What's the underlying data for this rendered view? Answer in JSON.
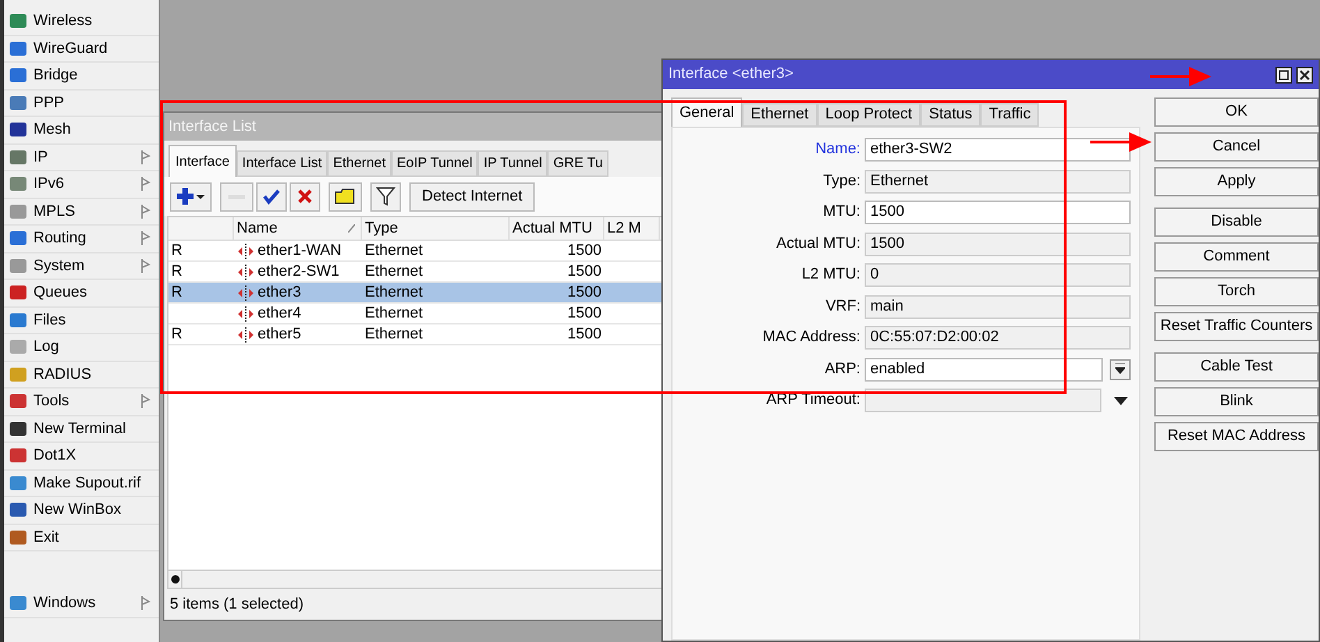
{
  "sidebar": {
    "items": [
      {
        "label": "Wireless",
        "submenu": false
      },
      {
        "label": "WireGuard",
        "submenu": false
      },
      {
        "label": "Bridge",
        "submenu": false
      },
      {
        "label": "PPP",
        "submenu": false
      },
      {
        "label": "Mesh",
        "submenu": false
      },
      {
        "label": "IP",
        "submenu": true
      },
      {
        "label": "IPv6",
        "submenu": true
      },
      {
        "label": "MPLS",
        "submenu": true
      },
      {
        "label": "Routing",
        "submenu": true
      },
      {
        "label": "System",
        "submenu": true
      },
      {
        "label": "Queues",
        "submenu": false
      },
      {
        "label": "Files",
        "submenu": false
      },
      {
        "label": "Log",
        "submenu": false
      },
      {
        "label": "RADIUS",
        "submenu": false
      },
      {
        "label": "Tools",
        "submenu": true
      },
      {
        "label": "New Terminal",
        "submenu": false
      },
      {
        "label": "Dot1X",
        "submenu": false
      },
      {
        "label": "Make Supout.rif",
        "submenu": false
      },
      {
        "label": "New WinBox",
        "submenu": false
      },
      {
        "label": "Exit",
        "submenu": false
      }
    ],
    "bottom_item": {
      "label": "Windows",
      "submenu": true
    }
  },
  "interface_list": {
    "title": "Interface List",
    "tabs": [
      {
        "label": "Interface",
        "selected": true
      },
      {
        "label": "Interface List",
        "selected": false
      },
      {
        "label": "Ethernet",
        "selected": false
      },
      {
        "label": "EoIP Tunnel",
        "selected": false
      },
      {
        "label": "IP Tunnel",
        "selected": false
      },
      {
        "label": "GRE Tu",
        "selected": false
      }
    ],
    "toolbar": {
      "disabled_remove": true,
      "detect_button": "Detect Internet"
    },
    "columns": [
      "Name",
      "Type",
      "Actual MTU",
      "L2 M"
    ],
    "rows": [
      {
        "flag": "R",
        "name": "ether1-WAN",
        "type": "Ethernet",
        "actual_mtu": "1500",
        "selected": false
      },
      {
        "flag": "R",
        "name": "ether2-SW1",
        "type": "Ethernet",
        "actual_mtu": "1500",
        "selected": false
      },
      {
        "flag": "R",
        "name": "ether3",
        "type": "Ethernet",
        "actual_mtu": "1500",
        "selected": true
      },
      {
        "name": "ether4",
        "type": "Ethernet",
        "actual_mtu": "1500",
        "selected": false
      },
      {
        "flag": "R",
        "name": "ether5",
        "type": "Ethernet",
        "actual_mtu": "1500",
        "selected": false
      }
    ],
    "status_bar": "5 items (1 selected)"
  },
  "dialog": {
    "title": "Interface <ether3>",
    "tabs": [
      {
        "label": "General",
        "selected": true
      },
      {
        "label": "Ethernet",
        "selected": false
      },
      {
        "label": "Loop Protect",
        "selected": false
      },
      {
        "label": "Status",
        "selected": false
      },
      {
        "label": "Traffic",
        "selected": false
      }
    ],
    "fields": [
      {
        "label": "Name:",
        "value": "ether3-SW2",
        "editable": true,
        "focused": true,
        "kind": "text"
      },
      {
        "label": "Type:",
        "value": "Ethernet",
        "editable": false,
        "focused": false,
        "kind": "text"
      },
      {
        "label": "MTU:",
        "value": "1500",
        "editable": true,
        "focused": false,
        "kind": "text"
      },
      {
        "label": "Actual MTU:",
        "value": "1500",
        "editable": false,
        "focused": false,
        "kind": "text"
      },
      {
        "label": "L2 MTU:",
        "value": "0",
        "editable": false,
        "focused": false,
        "kind": "text"
      },
      {
        "label": "VRF:",
        "value": "main",
        "editable": false,
        "focused": false,
        "kind": "text"
      },
      {
        "label": "MAC Address:",
        "value": "0C:55:07:D2:00:02",
        "editable": false,
        "focused": false,
        "kind": "text"
      },
      {
        "label": "ARP:",
        "value": "enabled",
        "editable": true,
        "focused": false,
        "kind": "select"
      },
      {
        "label": "ARP Timeout:",
        "editable": false,
        "focused": false,
        "kind": "optional"
      }
    ],
    "button_groups": [
      [
        "OK",
        "Cancel",
        "Apply"
      ],
      [
        "Disable",
        "Comment",
        "Torch",
        "Reset Traffic Counters"
      ],
      [
        "Cable Test",
        "Blink",
        "Reset MAC Address"
      ]
    ]
  }
}
